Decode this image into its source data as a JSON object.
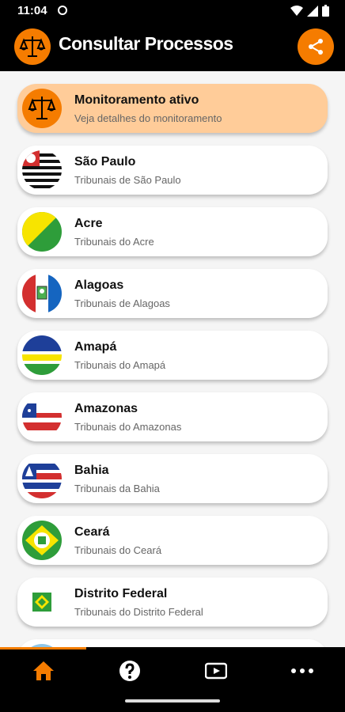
{
  "status_bar": {
    "time": "11:04"
  },
  "app_bar": {
    "title": "Consultar Processos",
    "logo_icon": "scales-icon",
    "share_icon": "share-icon"
  },
  "monitor_card": {
    "title": "Monitoramento ativo",
    "subtitle": "Veja detalhes do monitoramento"
  },
  "states": [
    {
      "name": "São Paulo",
      "subtitle": "Tribunais de São Paulo"
    },
    {
      "name": "Acre",
      "subtitle": "Tribunais do Acre"
    },
    {
      "name": "Alagoas",
      "subtitle": "Tribunais de Alagoas"
    },
    {
      "name": "Amapá",
      "subtitle": "Tribunais do Amapá"
    },
    {
      "name": "Amazonas",
      "subtitle": "Tribunais do Amazonas"
    },
    {
      "name": "Bahia",
      "subtitle": "Tribunais da Bahia"
    },
    {
      "name": "Ceará",
      "subtitle": "Tribunais do Ceará"
    },
    {
      "name": "Distrito Federal",
      "subtitle": "Tribunais do Distrito Federal"
    }
  ],
  "bottom_nav": {
    "items": [
      "home-icon",
      "help-icon",
      "video-icon",
      "more-icon"
    ],
    "active": "home-icon"
  },
  "colors": {
    "accent": "#f57c00",
    "active_card": "#ffcc99"
  }
}
